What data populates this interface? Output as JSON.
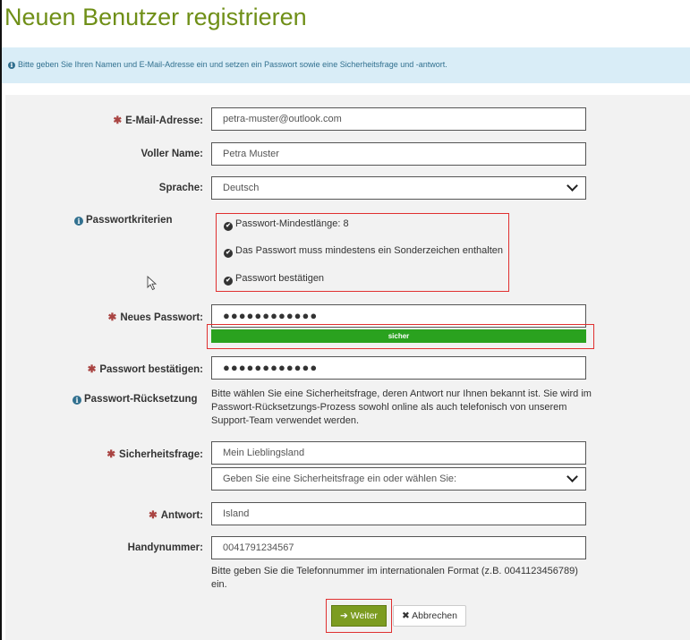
{
  "page": {
    "title": "Neuen Benutzer registrieren",
    "info_text": "Bitte geben Sie Ihren Namen und E-Mail-Adresse ein und setzen ein Passwort sowie eine Sicherheitsfrage und -antwort."
  },
  "fields": {
    "email": {
      "label": "E-Mail-Adresse:",
      "value": "petra-muster@outlook.com"
    },
    "fullname": {
      "label": "Voller Name:",
      "value": "Petra Muster"
    },
    "language": {
      "label": "Sprache:",
      "value": "Deutsch"
    },
    "password": {
      "label": "Neues Passwort:",
      "value": "●●●●●●●●●●●●"
    },
    "password_strength": {
      "label": "sicher",
      "level": 1.0,
      "color": "#2aa21f"
    },
    "password_confirm": {
      "label": "Passwort bestätigen:",
      "value": "●●●●●●●●●●●●"
    },
    "security_question": {
      "label": "Sicherheitsfrage:",
      "value": "Mein Lieblingsland"
    },
    "security_question_select": {
      "value": "Geben Sie eine Sicherheitsfrage ein oder wählen Sie:"
    },
    "answer": {
      "label": "Antwort:",
      "value": "Island"
    },
    "phone": {
      "label": "Handynummer:",
      "value": "0041791234567"
    }
  },
  "criteria": {
    "label": "Passwortkriterien",
    "items": [
      "Passwort-Mindestlänge: 8",
      "Das Passwort muss mindestens ein Sonderzeichen enthalten",
      "Passwort bestätigen"
    ]
  },
  "reset": {
    "label": "Passwort-Rücksetzung",
    "text": "Bitte wählen Sie eine Sicherheitsfrage, deren Antwort nur Ihnen bekannt ist. Sie wird im Passwort-Rücksetzungs-Prozess sowohl online als auch telefonisch von unserem Support-Team verwendet werden."
  },
  "phone_hint": "Bitte geben Sie die Telefonnummer im internationalen Format (z.B. 0041123456789) ein.",
  "buttons": {
    "next": "Weiter",
    "cancel": "Abbrechen"
  },
  "colors": {
    "title": "#6f8f17",
    "info_bg": "#d9edf7",
    "required": "#a94442",
    "primary_button": "#7c9c21",
    "highlight": "#e03030"
  },
  "icons": {
    "info": "info-circle-icon",
    "required": "asterisk-icon",
    "check": "check-circle-icon",
    "arrow": "arrow-right-icon",
    "cancel": "close-icon",
    "dropdown": "chevron-down-icon",
    "cursor": "mouse-pointer-icon"
  }
}
